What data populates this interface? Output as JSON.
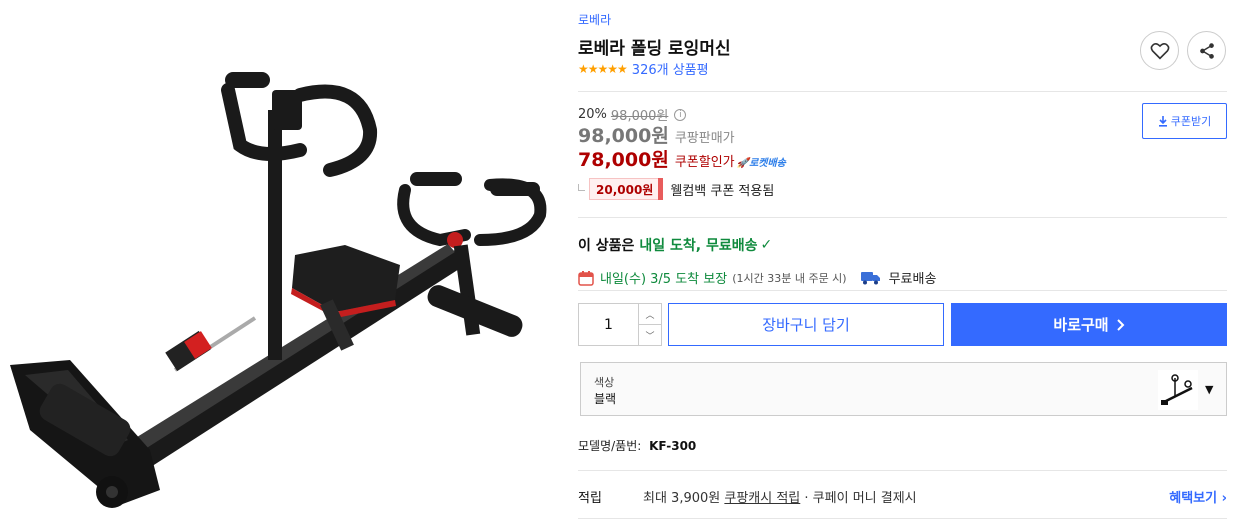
{
  "product": {
    "brand": "로베라",
    "title": "로베라 폴딩 로잉머신",
    "rating_stars": "★★★★★",
    "review_count": "326개 상품평"
  },
  "price": {
    "discount_rate": "20%",
    "original_price": "98,000원",
    "info_icon": "i",
    "sale_price": "98,000원",
    "sale_label": "쿠팡판매가",
    "coupon_price": "78,000원",
    "coupon_label": "쿠폰할인가",
    "rocket_badge": "🚀로켓배송",
    "coupon_download_label": "쿠폰받기",
    "welcome_coupon_amount": "20,000원",
    "welcome_coupon_text": "웰컴백 쿠폰 적용됨"
  },
  "delivery": {
    "headline_prefix": "이 상품은",
    "headline_highlight": "내일 도착, 무료배송",
    "arrival": "내일(수) 3/5 도착 보장",
    "order_by": "(1시간 33분 내 주문 시)",
    "free_shipping": "무료배송"
  },
  "purchase": {
    "quantity": "1",
    "cart_label": "장바구니 담기",
    "buy_label": "바로구매"
  },
  "option": {
    "label": "색상",
    "value": "블랙"
  },
  "model": {
    "label": "모델명/품번:",
    "value": "KF-300"
  },
  "benefit": {
    "label": "적립",
    "desc_prefix": "최대 3,900원 ",
    "desc_link": "쿠팡캐시 적립",
    "desc_suffix": " · 쿠페이 머니 결제시",
    "more_label": "혜택보기 ›"
  },
  "colors": {
    "accent_blue": "#346aff",
    "coupon_red": "#ae0000",
    "delivery_green": "#0f8a3d",
    "star_orange": "#ff9f00"
  },
  "icons": [
    "heart-icon",
    "share-icon",
    "download-icon",
    "calendar-icon",
    "truck-icon",
    "check-icon",
    "chevron-right-icon",
    "caret-down-icon"
  ]
}
